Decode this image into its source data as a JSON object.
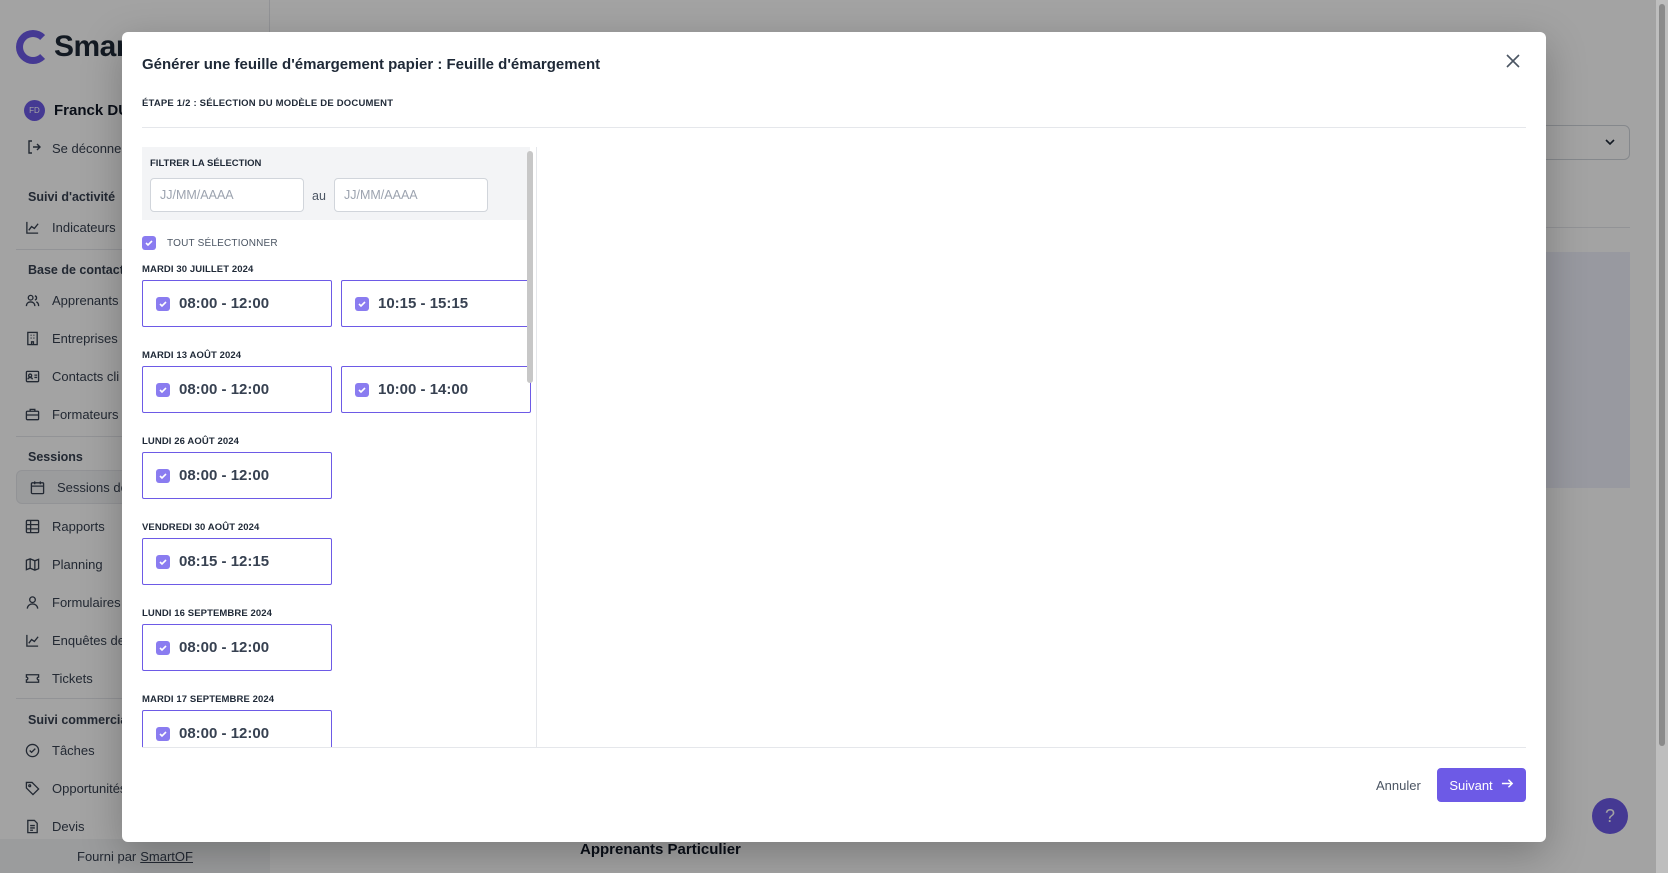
{
  "sidebar": {
    "logo_text": "Smar",
    "user": {
      "initials": "FD",
      "name": "Franck DU"
    },
    "logout_label": "Se déconne",
    "sections": {
      "activity": "Suivi d'activité",
      "contacts": "Base de contact",
      "sessions": "Sessions",
      "commercial": "Suivi commercia"
    },
    "items": {
      "indicateurs": "Indicateurs",
      "apprenants": "Apprenants",
      "entreprises": "Entreprises",
      "contacts": "Contacts cli",
      "formateurs": "Formateurs",
      "sessions": "Sessions de",
      "rapports": "Rapports",
      "planning": "Planning",
      "formulaires": "Formulaires",
      "enquetes": "Enquêtes de",
      "tickets": "Tickets",
      "taches": "Tâches",
      "opportunites": "Opportunités",
      "devis": "Devis"
    },
    "footer": {
      "prefix": "Fourni par",
      "link": "SmartOF"
    }
  },
  "background": {
    "section_title": "Apprenants Particulier"
  },
  "modal": {
    "title": "Générer une feuille d'émargement papier : Feuille d'émargement",
    "step": "Étape 1/2 : Sélection du modèle de document",
    "filter": {
      "title": "Filtrer la sélection",
      "from_placeholder": "JJ/MM/AAAA",
      "to_placeholder": "JJ/MM/AAAA",
      "separator": "au"
    },
    "select_all_label": "Tout sélectionner",
    "days": [
      {
        "label": "Mardi 30 juillet 2024",
        "slots": [
          "08:00 - 12:00",
          "10:15 - 15:15"
        ]
      },
      {
        "label": "Mardi 13 août 2024",
        "slots": [
          "08:00 - 12:00",
          "10:00 - 14:00"
        ]
      },
      {
        "label": "Lundi 26 août 2024",
        "slots": [
          "08:00 - 12:00"
        ]
      },
      {
        "label": "Vendredi 30 août 2024",
        "slots": [
          "08:15 - 12:15"
        ]
      },
      {
        "label": "Lundi 16 septembre 2024",
        "slots": [
          "08:00 - 12:00"
        ]
      },
      {
        "label": "Mardi 17 septembre 2024",
        "slots": [
          "08:00 - 12:00"
        ]
      }
    ],
    "cancel_label": "Annuler",
    "next_label": "Suivant"
  },
  "help_label": "?",
  "colors": {
    "accent": "#6d5ae6"
  }
}
